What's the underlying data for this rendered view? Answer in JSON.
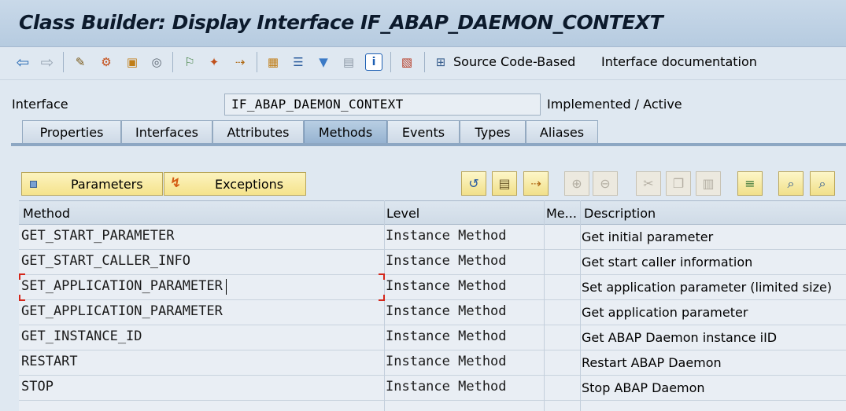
{
  "window": {
    "title": "Class Builder: Display Interface IF_ABAP_DAEMON_CONTEXT"
  },
  "toolbar": {
    "source_code_based": "Source Code-Based",
    "interface_documentation": "Interface documentation",
    "icons": [
      "back-icon",
      "forward-icon",
      "other-object-icon",
      "display-change-icon",
      "active-inactive-icon",
      "where-used-icon",
      "check-icon",
      "activate-icon",
      "test-icon",
      "object-list-icon",
      "navigation-window-icon",
      "filter-icon",
      "class-documentation-icon",
      "information-icon",
      "hierarchy-icon",
      "source-code-based-icon"
    ]
  },
  "header": {
    "interface_label": "Interface",
    "interface_value": "IF_ABAP_DAEMON_CONTEXT",
    "status": "Implemented / Active"
  },
  "tabs": [
    {
      "label": "Properties",
      "active": false
    },
    {
      "label": "Interfaces",
      "active": false
    },
    {
      "label": "Attributes",
      "active": false
    },
    {
      "label": "Methods",
      "active": true
    },
    {
      "label": "Events",
      "active": false
    },
    {
      "label": "Types",
      "active": false
    },
    {
      "label": "Aliases",
      "active": false
    }
  ],
  "methods_toolbar": {
    "parameters": "Parameters",
    "exceptions": "Exceptions",
    "buttons": [
      "source-code-icon",
      "detail-view-icon",
      "navigate-icon",
      "insert-row-icon",
      "delete-row-icon",
      "cut-icon",
      "copy-icon",
      "paste-icon",
      "sort-icon",
      "find-icon",
      "find-next-icon"
    ]
  },
  "table": {
    "columns": [
      "Method",
      "Level",
      "Me...",
      "Description"
    ],
    "rows": [
      {
        "method": "GET_START_PARAMETER",
        "level": "Instance Method",
        "me": "",
        "description": "Get initial parameter"
      },
      {
        "method": "GET_START_CALLER_INFO",
        "level": "Instance Method",
        "me": "",
        "description": "Get start caller information"
      },
      {
        "method": "SET_APPLICATION_PARAMETER",
        "level": "Instance Method",
        "me": "",
        "description": "Set application parameter (limited size)"
      },
      {
        "method": "GET_APPLICATION_PARAMETER",
        "level": "Instance Method",
        "me": "",
        "description": "Get application parameter"
      },
      {
        "method": "GET_INSTANCE_ID",
        "level": "Instance Method",
        "me": "",
        "description": "Get ABAP Daemon instance iID"
      },
      {
        "method": "RESTART",
        "level": "Instance Method",
        "me": "",
        "description": "Restart ABAP Daemon"
      },
      {
        "method": "STOP",
        "level": "Instance Method",
        "me": "",
        "description": "Stop ABAP Daemon"
      }
    ],
    "selected_row": 2
  },
  "colors": {
    "title_bg": "#c3d5e8",
    "body_bg": "#dfe8f1",
    "active_tab": "#a7c1db",
    "button_yellow": "#f7e69a",
    "focus_marker": "#d4261a"
  }
}
